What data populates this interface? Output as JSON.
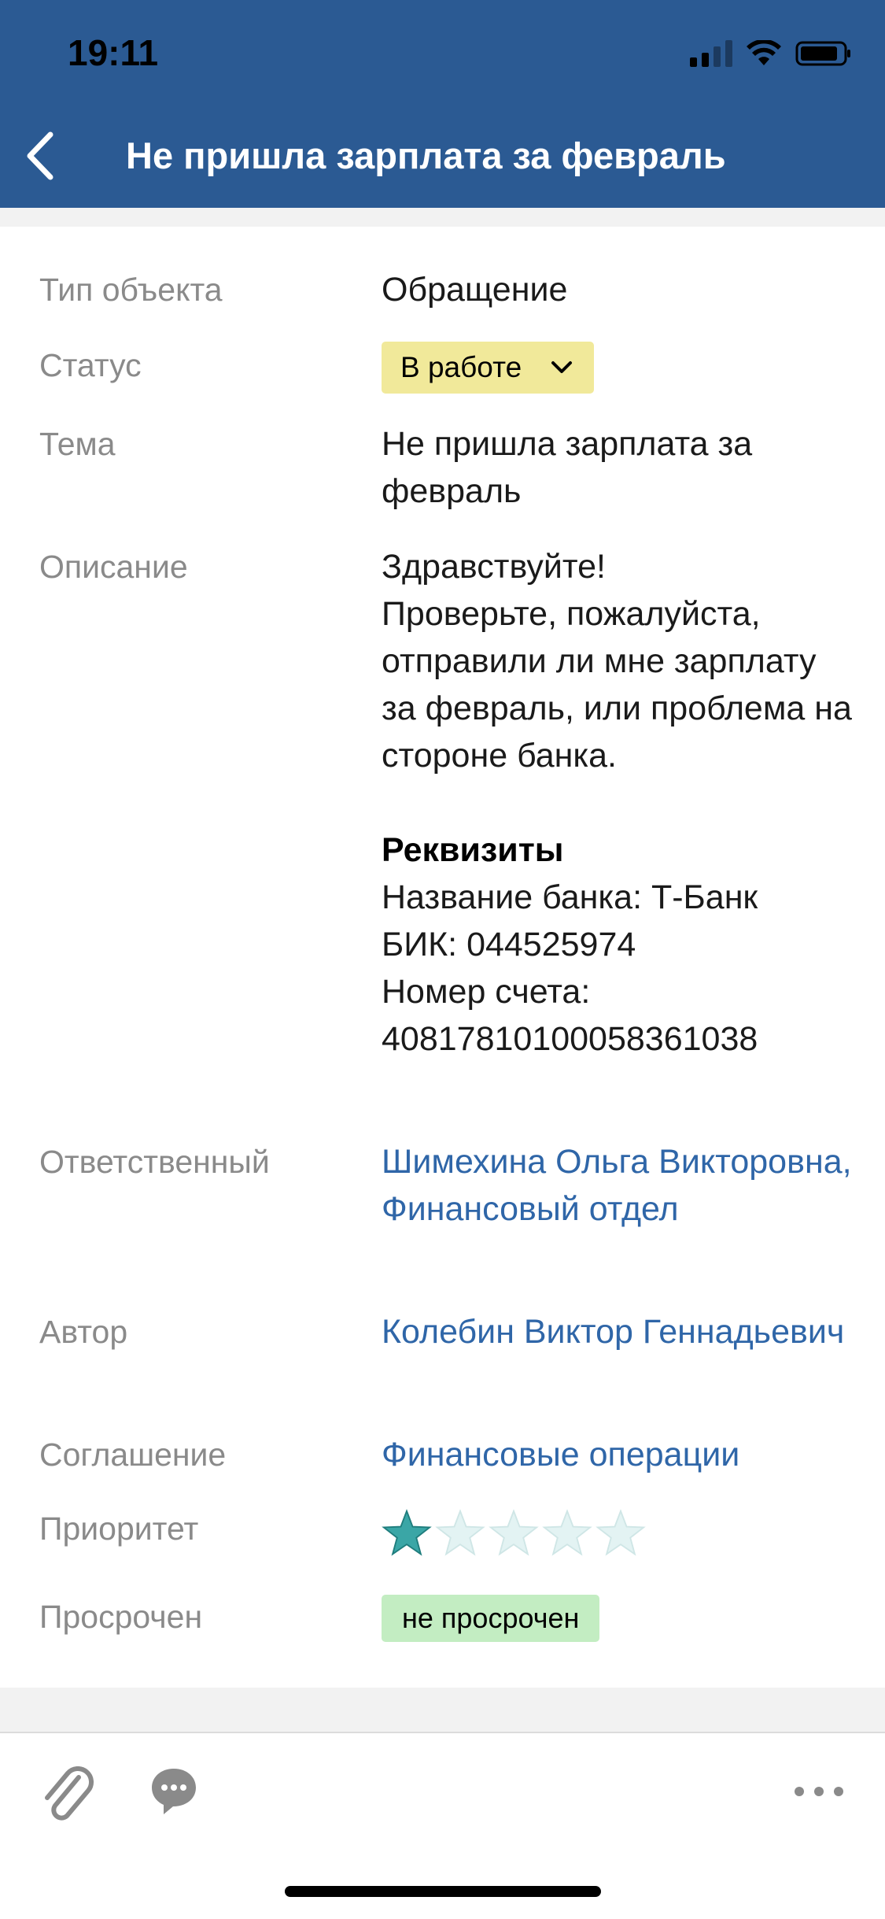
{
  "status_bar": {
    "time": "19:11"
  },
  "nav": {
    "title": "Не пришла зарплата за февраль",
    "back_icon": "chevron-left-icon"
  },
  "fields": {
    "object_type": {
      "label": "Тип объекта",
      "value": "Обращение"
    },
    "status": {
      "label": "Статус",
      "value": "В работе",
      "color": "#f1e99a"
    },
    "subject": {
      "label": "Тема",
      "value": "Не пришла зарплата за февраль"
    },
    "description": {
      "label": "Описание",
      "text": "Здравствуйте!\nПроверьте, пожалуйста, отправили ли мне зарплату за февраль, или проблема на стороне банка.",
      "details_heading": "Реквизиты",
      "bank": "Название банка: Т-Банк",
      "bik": "БИК: 044525974",
      "account_label": "Номер счета:",
      "account_number": "40817810100058361038"
    },
    "responsible": {
      "label": "Ответственный",
      "value": "Шимехина Ольга Викторовна, Финансовый отдел"
    },
    "author": {
      "label": "Автор",
      "value": "Колебин Виктор Геннадьевич"
    },
    "agreement": {
      "label": "Соглашение",
      "value": "Финансовые операции"
    },
    "priority": {
      "label": "Приоритет",
      "rating": 1,
      "max": 5
    },
    "overdue": {
      "label": "Просрочен",
      "value": "не просрочен",
      "color": "#c3edc2"
    }
  },
  "colors": {
    "header": "#2b5a93",
    "link": "#2f66a8",
    "star": "#3aa6a6"
  },
  "toolbar": {
    "icons": [
      "paperclip-icon",
      "comment-icon",
      "more-icon"
    ]
  }
}
